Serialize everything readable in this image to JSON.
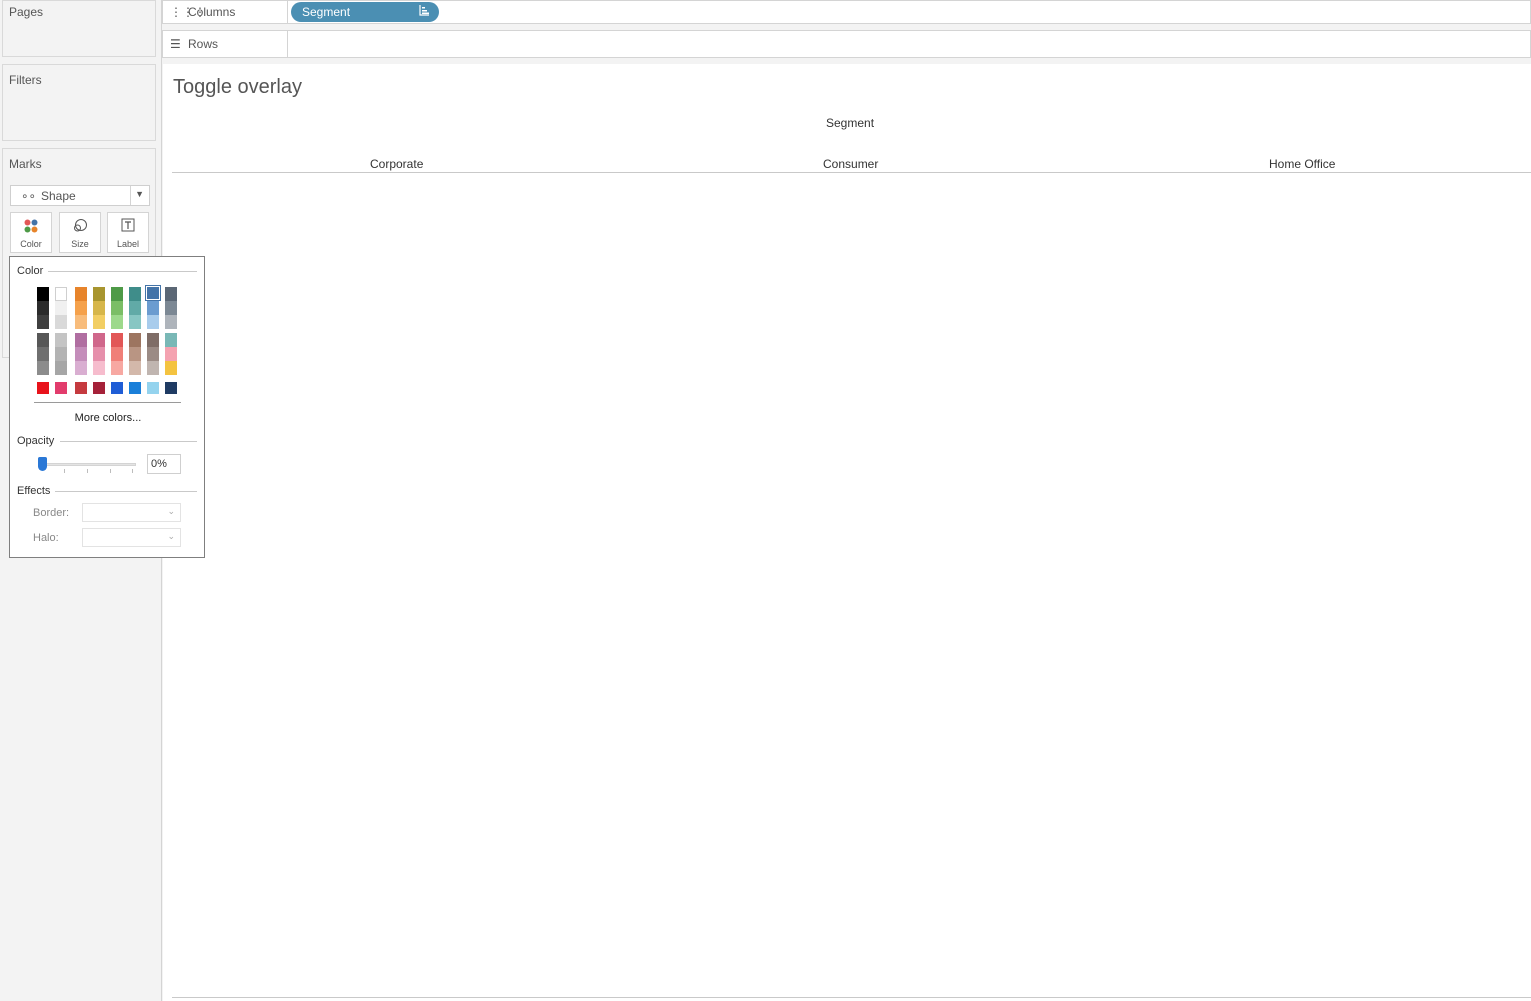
{
  "cards": {
    "pages": "Pages",
    "filters": "Filters",
    "marks": "Marks"
  },
  "shelves": {
    "columns": {
      "label": "Columns",
      "icon": "columns-icon",
      "pill": "Segment",
      "pill_icon": "sort-icon"
    },
    "rows": {
      "label": "Rows",
      "icon": "rows-icon"
    }
  },
  "marks": {
    "type_label": "Shape",
    "buttons": [
      {
        "label": "Color"
      },
      {
        "label": "Size"
      },
      {
        "label": "Label"
      }
    ]
  },
  "view": {
    "title": "Toggle overlay",
    "header_title": "Segment",
    "columns": [
      "Corporate",
      "Consumer",
      "Home Office"
    ]
  },
  "color_popup": {
    "color_title": "Color",
    "more_colors": "More colors...",
    "opacity_title": "Opacity",
    "opacity_value": "0%",
    "opacity_level": 0,
    "effects_title": "Effects",
    "border_label": "Border:",
    "halo_label": "Halo:",
    "palette_columns": [
      [
        "#000000",
        "#2b2b2b",
        "#3f3f3f",
        "#575757",
        "#6f6f6f",
        "#8c8c8c"
      ],
      [
        "#ffffff",
        "#f0f0f0",
        "#d9d9d9",
        "#c4c4c4",
        "#b3b3b3",
        "#a6a6a6"
      ],
      [
        "#e7842b",
        "#f5a14b",
        "#f8bc7b",
        "#b06ea1",
        "#c48dba",
        "#d9aed1"
      ],
      [
        "#a8952f",
        "#d6b64a",
        "#f2ce63",
        "#d0678b",
        "#e68fab",
        "#f6bccd"
      ],
      [
        "#4e9a47",
        "#7bbe66",
        "#9dd98c",
        "#e25757",
        "#f07f78",
        "#f7a8a2"
      ],
      [
        "#3f8d8a",
        "#61aaa7",
        "#87c6c3",
        "#9d7560",
        "#b99583",
        "#d3b8aa"
      ],
      [
        "#4474a8",
        "#6b9cd0",
        "#a8ccec",
        "#7f6d67",
        "#9b8b85",
        "#c0b5b0"
      ],
      [
        "#5b6775",
        "#7c8894",
        "#aeb4bb",
        "#79b8b6",
        "#f4a2b0",
        "#f4c340"
      ]
    ],
    "bright_row": [
      "#e8131b",
      "#e23c6c",
      "#c53a3f",
      "#a52139",
      "#1f5dd6",
      "#1a7fd9",
      "#94d3ee",
      "#1f3b63"
    ]
  }
}
